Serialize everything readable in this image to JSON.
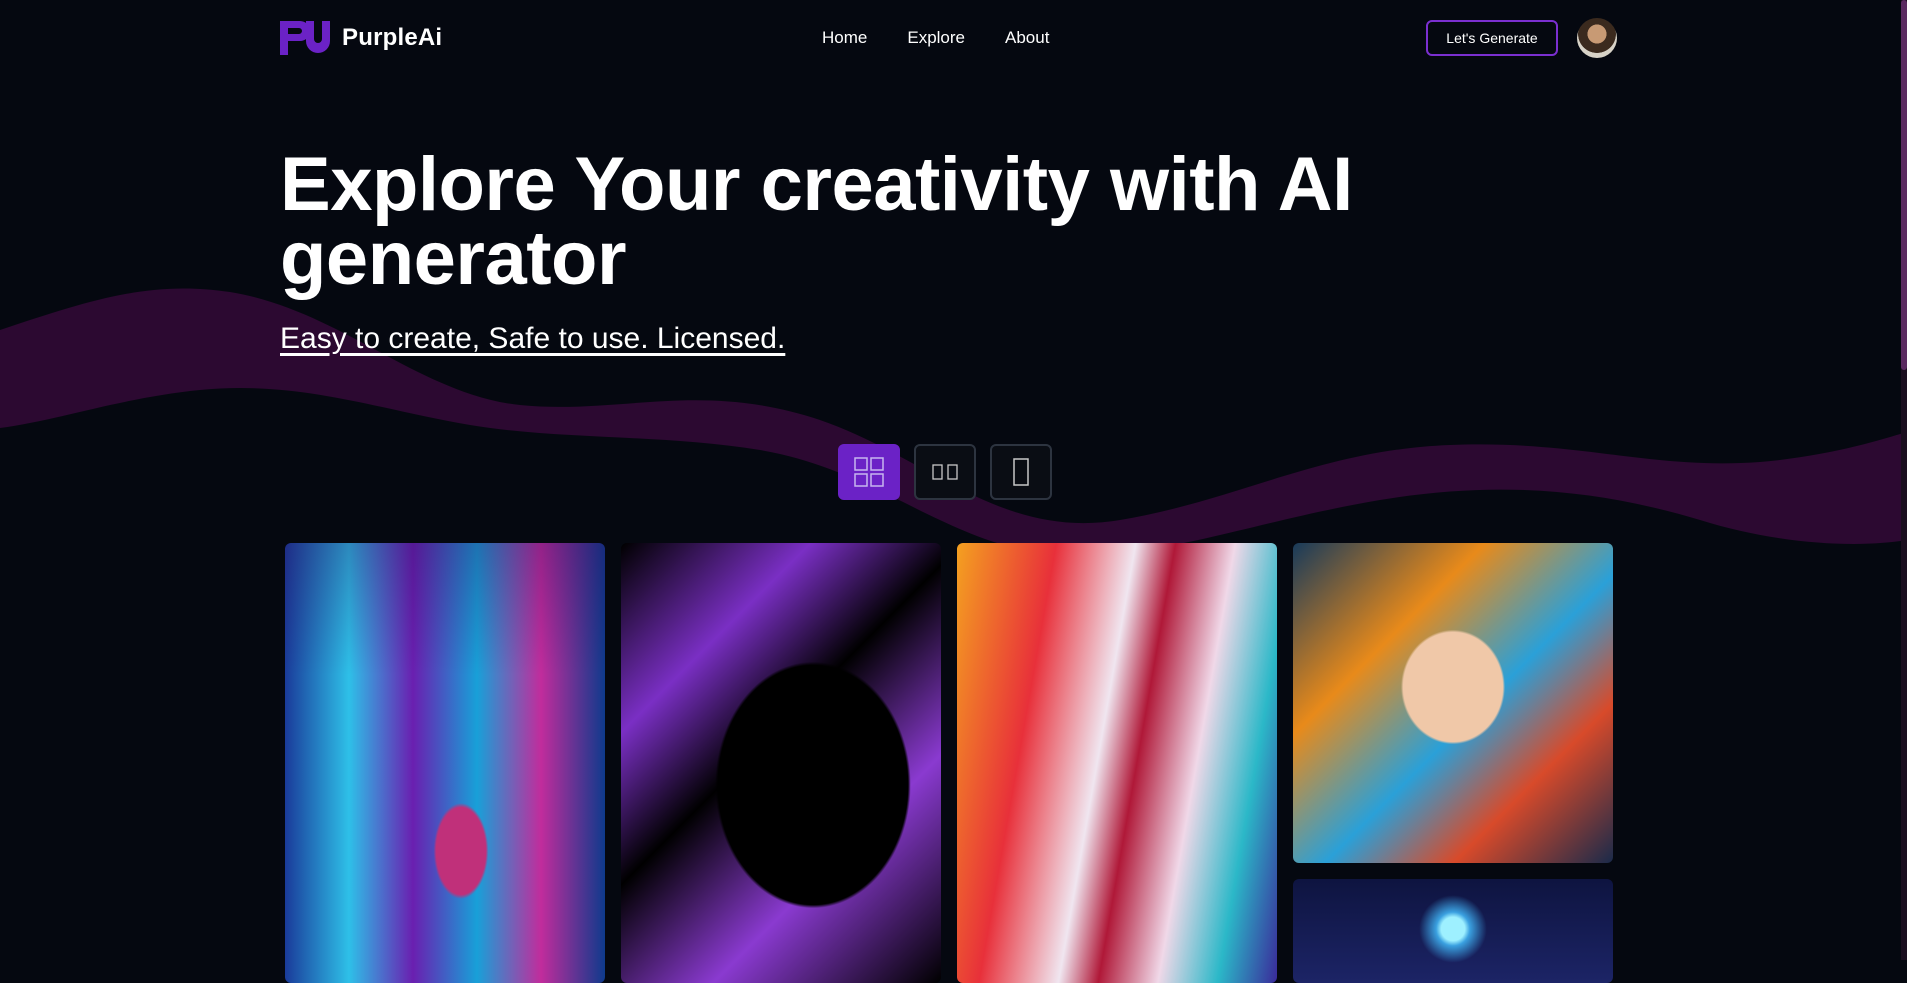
{
  "nav": {
    "logo_mark": "pu",
    "brand": "PurpleAi",
    "links": [
      "Home",
      "Explore",
      "About"
    ],
    "cta_label": "Let's Generate",
    "avatar_icon": "user-avatar"
  },
  "hero": {
    "title": "Explore Your creativity with AI generator",
    "subtitle": "Easy to create, Safe to use. Licensed."
  },
  "layout_toggles": [
    {
      "icon": "grid-4-icon",
      "active": true
    },
    {
      "icon": "grid-2-icon",
      "active": false
    },
    {
      "icon": "grid-1-icon",
      "active": false
    }
  ],
  "gallery": [
    {
      "name": "neon-city-girl-image"
    },
    {
      "name": "purple-anime-image"
    },
    {
      "name": "abstract-paint-image"
    },
    {
      "name": "painted-face-portrait-image"
    },
    {
      "name": "glowing-orb-image"
    }
  ],
  "colors": {
    "background": "#050810",
    "accent": "#6b22c6",
    "cta_border": "#7b2fd0",
    "wave": "#3a0a3c"
  }
}
